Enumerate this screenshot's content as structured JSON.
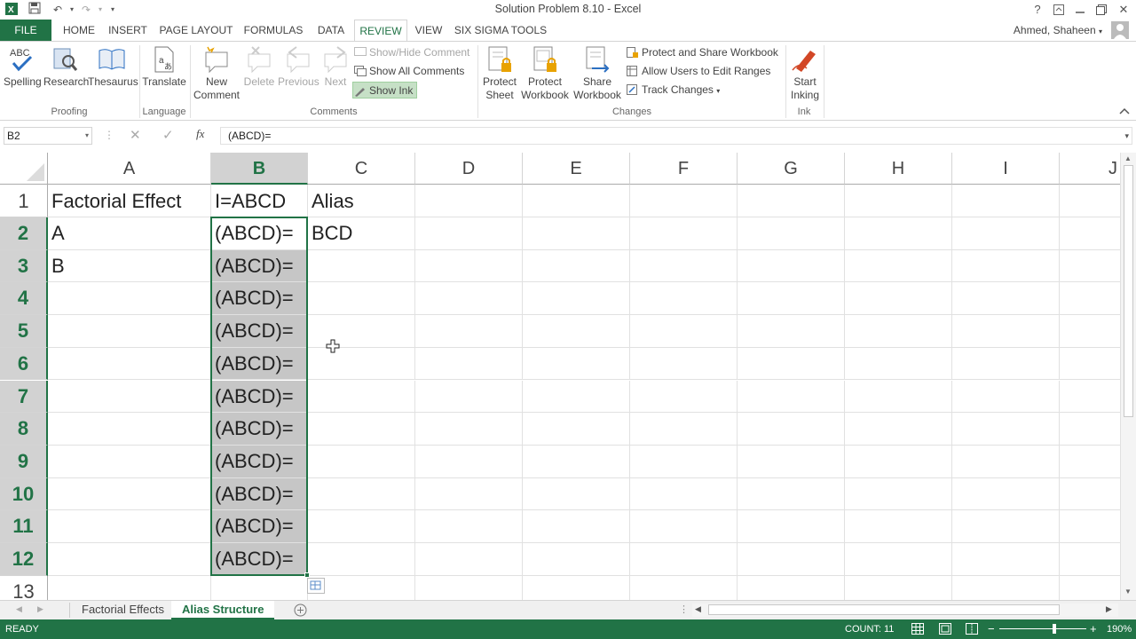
{
  "titlebar": {
    "title": "Solution Problem 8.10 - Excel"
  },
  "window_controls": {
    "help": "?",
    "restore_ribbon": "⬆",
    "minimize": "—",
    "maximize": "❐",
    "close": "✕"
  },
  "tabs": {
    "file": "FILE",
    "home": "HOME",
    "insert": "INSERT",
    "page_layout": "PAGE LAYOUT",
    "formulas": "FORMULAS",
    "data": "DATA",
    "review": "REVIEW",
    "view": "VIEW",
    "six_sigma": "SIX SIGMA TOOLS"
  },
  "user": "Ahmed, Shaheen",
  "ribbon": {
    "proofing": {
      "spelling": "Spelling",
      "research": "Research",
      "thesaurus": "Thesaurus",
      "group": "Proofing"
    },
    "language": {
      "translate": "Translate",
      "group": "Language"
    },
    "comments": {
      "new_comment_1": "New",
      "new_comment_2": "Comment",
      "delete": "Delete",
      "previous": "Previous",
      "next": "Next",
      "show_hide": "Show/Hide Comment",
      "show_all": "Show All Comments",
      "show_ink": "Show Ink",
      "group": "Comments"
    },
    "changes": {
      "protect_sheet_1": "Protect",
      "protect_sheet_2": "Sheet",
      "protect_workbook_1": "Protect",
      "protect_workbook_2": "Workbook",
      "share_workbook_1": "Share",
      "share_workbook_2": "Workbook",
      "protect_share": "Protect and Share Workbook",
      "allow_users": "Allow Users to Edit Ranges",
      "track_changes": "Track Changes",
      "group": "Changes"
    },
    "ink": {
      "start_1": "Start",
      "start_2": "Inking",
      "group": "Ink"
    }
  },
  "formula_bar": {
    "name_box": "B2",
    "fx": "fx",
    "content": "(ABCD)="
  },
  "columns": [
    "A",
    "B",
    "C",
    "D",
    "E",
    "F",
    "G",
    "H",
    "I",
    "J"
  ],
  "rows": [
    "1",
    "2",
    "3",
    "4",
    "5",
    "6",
    "7",
    "8",
    "9",
    "10",
    "11",
    "12",
    "13"
  ],
  "cells": {
    "A1": "Factorial Effect",
    "B1": "I=ABCD",
    "C1": "Alias",
    "A2": "A",
    "B2": "(ABCD)=",
    "C2": "BCD",
    "A3": "B",
    "B3": "(ABCD)=",
    "B4": "(ABCD)=",
    "B5": "(ABCD)=",
    "B6": "(ABCD)=",
    "B7": "(ABCD)=",
    "B8": "(ABCD)=",
    "B9": "(ABCD)=",
    "B10": "(ABCD)=",
    "B11": "(ABCD)=",
    "B12": "(ABCD)="
  },
  "sheets": [
    "Factorial Effects",
    "Alias Structure"
  ],
  "active_sheet": "Alias Structure",
  "status": {
    "ready": "READY",
    "count": "COUNT: 11",
    "zoom": "190%"
  },
  "colors": {
    "accent": "#217346",
    "selection": "#c6c6c6",
    "header_selected": "#d2d2d2"
  }
}
